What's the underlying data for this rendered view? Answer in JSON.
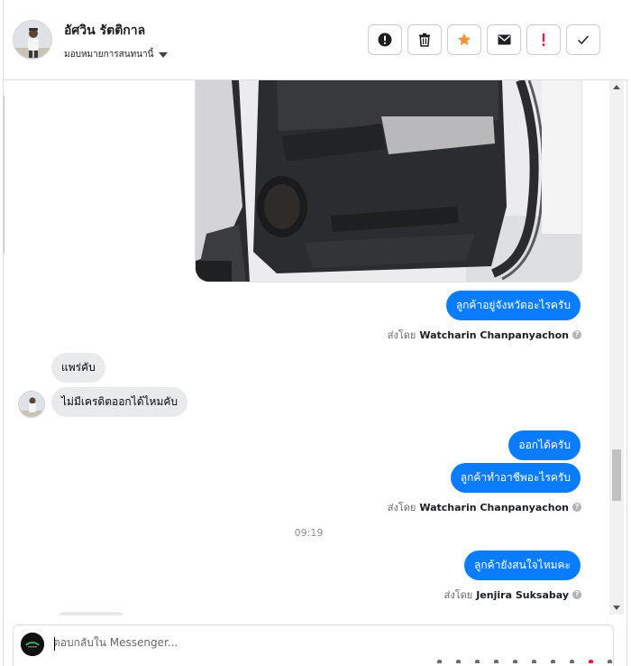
{
  "header": {
    "contact_name": "อัศวิน รัตติกาล",
    "assign_label": "มอบหมายการสนทนานี้",
    "toolbar": [
      {
        "icon": "alert-circle-icon",
        "name": "mark-spam-button"
      },
      {
        "icon": "trash-icon",
        "name": "delete-button"
      },
      {
        "icon": "star-icon",
        "name": "star-button"
      },
      {
        "icon": "envelope-icon",
        "name": "mark-unread-button"
      },
      {
        "icon": "exclamation-icon",
        "name": "follow-up-button"
      },
      {
        "icon": "check-icon",
        "name": "mark-done-button"
      }
    ]
  },
  "colors": {
    "outgoing_bubble": "#0a7cff",
    "incoming_bubble": "#e9eaec",
    "star": "#f7923a",
    "follow_up": "#e41e3f"
  },
  "messages": {
    "out1": "ลูกค้าอยู่จังหวัดอะไรครับ",
    "sent1_prefix": "ส่งโดย",
    "sent1_name": "Watcharin Chanpanyachon",
    "in1": "แพร่คับ",
    "in2": "ไม่มีเครดิตออกได้ไหมคับ",
    "out2": "ออกได้ครับ",
    "out3": "ลูกค้าทำอาชีพอะไรครับ",
    "sent2_prefix": "ส่งโดย",
    "sent2_name": "Watcharin Chanpanyachon",
    "time_separator": "09:19",
    "out4": "ลูกค้ายังสนใจไหมคะ",
    "sent3_prefix": "ส่งโดย",
    "sent3_name": "Jenjira Suksabay"
  },
  "composer": {
    "placeholder": "ตอบกลับใน Messenger..."
  }
}
